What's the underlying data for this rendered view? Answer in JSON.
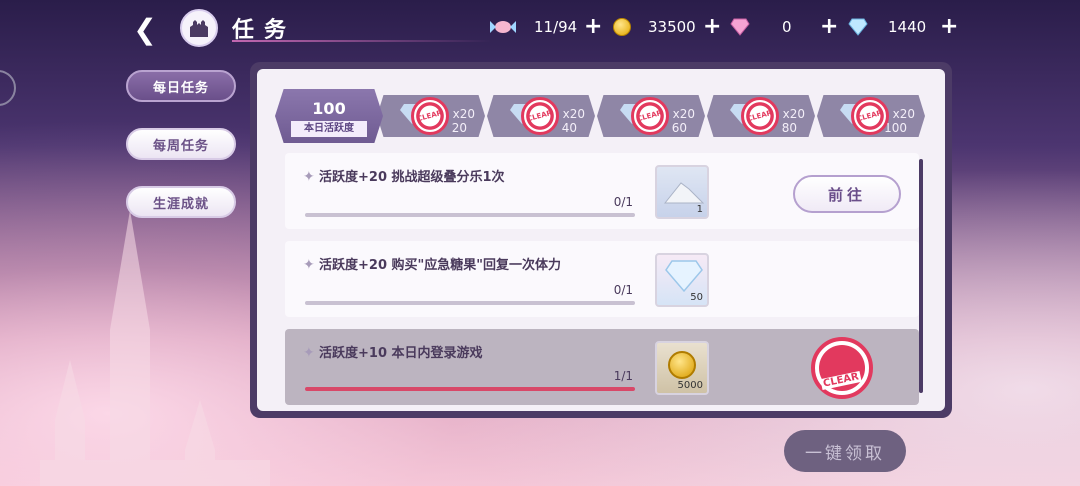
{
  "header": {
    "title": "任务",
    "stamina_value": "11/94",
    "coins_value": "33500",
    "pink_gem_value": "0",
    "blue_gem_value": "1440"
  },
  "sidebar": {
    "tabs": [
      {
        "label": "每日任务",
        "active": true
      },
      {
        "label": "每周任务",
        "active": false
      },
      {
        "label": "生涯成就",
        "active": false
      }
    ]
  },
  "activity": {
    "total": "100",
    "label": "本日活跃度",
    "milestones": [
      {
        "threshold": "20",
        "count": "x20",
        "claimed": true
      },
      {
        "threshold": "40",
        "count": "x20",
        "claimed": true
      },
      {
        "threshold": "60",
        "count": "x20",
        "claimed": true
      },
      {
        "threshold": "80",
        "count": "x20",
        "claimed": true
      },
      {
        "threshold": "100",
        "count": "x20",
        "claimed": true
      }
    ]
  },
  "tasks": [
    {
      "text": "活跃度+20 挑战超级叠分乐1次",
      "progress_text": "0/1",
      "progress": 0,
      "reward_count": "1",
      "reward_icon": "silver-pile-icon",
      "button": "前往",
      "done": false
    },
    {
      "text": "活跃度+20 购买\"应急糖果\"回复一次体力",
      "progress_text": "0/1",
      "progress": 0,
      "reward_count": "50",
      "reward_icon": "diamond-icon",
      "button": "",
      "done": false
    },
    {
      "text": "活跃度+10  本日内登录游戏",
      "progress_text": "1/1",
      "progress": 1,
      "reward_count": "5000",
      "reward_icon": "coin-icon",
      "button": "",
      "done": true
    }
  ],
  "stamp_text": "CLEAR",
  "collect_all_label": "一键领取",
  "colors": {
    "accent": "#e2395e",
    "panel": "#4c3b66",
    "tab_active": "#7a5f99"
  }
}
